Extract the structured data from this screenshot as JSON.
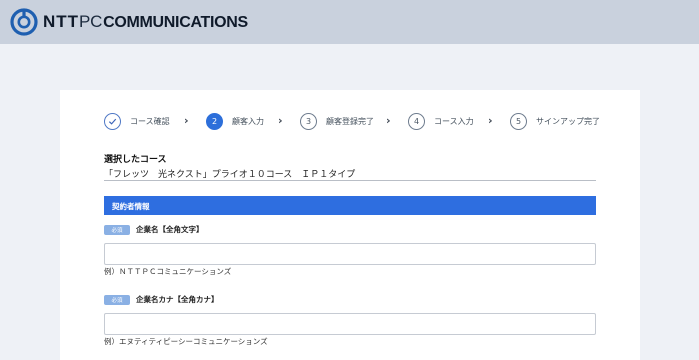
{
  "brand": {
    "ntt": "NTT",
    "pc": "PC",
    "comm": "COMMUNICATIONS",
    "color": "#1e5fb0"
  },
  "stepper": {
    "steps": [
      {
        "marker": "",
        "label": "コース確認",
        "state": "done"
      },
      {
        "marker": "2",
        "label": "顧客入力",
        "state": "active"
      },
      {
        "marker": "3",
        "label": "顧客登録完了",
        "state": "pending"
      },
      {
        "marker": "4",
        "label": "コース入力",
        "state": "pending"
      },
      {
        "marker": "5",
        "label": "サインアップ完了",
        "state": "pending"
      }
    ],
    "arrow": "›"
  },
  "course": {
    "heading": "選択したコース",
    "name": "「フレッツ　光ネクスト」プライオ１０コース　ＩＰ１タイプ"
  },
  "contract": {
    "section_title": "契約者情報"
  },
  "fields": [
    {
      "required_badge": "必須",
      "label": "企業名【全角文字】",
      "value": "",
      "example": "例）ＮＴＴＰＣコミュニケーションズ"
    },
    {
      "required_badge": "必須",
      "label": "企業名カナ【全角カナ】",
      "value": "",
      "example": "例）エヌティティピーシーコミュニケーションズ"
    }
  ],
  "colors": {
    "accent": "#2e6ee0",
    "header_bg": "#c9d1dd",
    "page_bg": "#eef1f6"
  }
}
